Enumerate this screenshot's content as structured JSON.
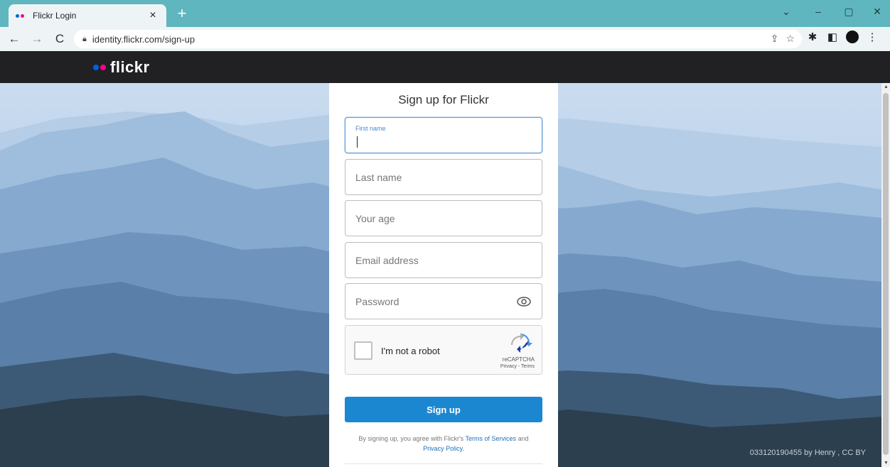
{
  "browser": {
    "tab_title": "Flickr Login",
    "tab_close": "×",
    "new_tab": "+",
    "url": "identity.flickr.com/sign-up",
    "window_controls": [
      "⌄",
      "–",
      "▢",
      "✕"
    ]
  },
  "header": {
    "logo_text": "flickr",
    "brand_colors": {
      "blue": "#0063dc",
      "pink": "#ff0084",
      "header_bg": "#212124"
    }
  },
  "form": {
    "title": "Sign up for Flickr",
    "fields": {
      "first_name": "First name",
      "last_name": "Last name",
      "age": "Your age",
      "email": "Email address",
      "password": "Password"
    },
    "recaptcha": {
      "label": "I'm not a robot",
      "brand": "reCAPTCHA",
      "links": "Privacy - Terms"
    },
    "submit_label": "Sign up",
    "legal": {
      "prefix": "By signing up, you agree with Flickr's",
      "terms_link": "Terms of Services",
      "conjunction": "and",
      "privacy_link": "Privacy Policy."
    },
    "accent_color": "#1c87d1"
  },
  "background": {
    "credit": "033120190455 by Henry , CC BY"
  }
}
